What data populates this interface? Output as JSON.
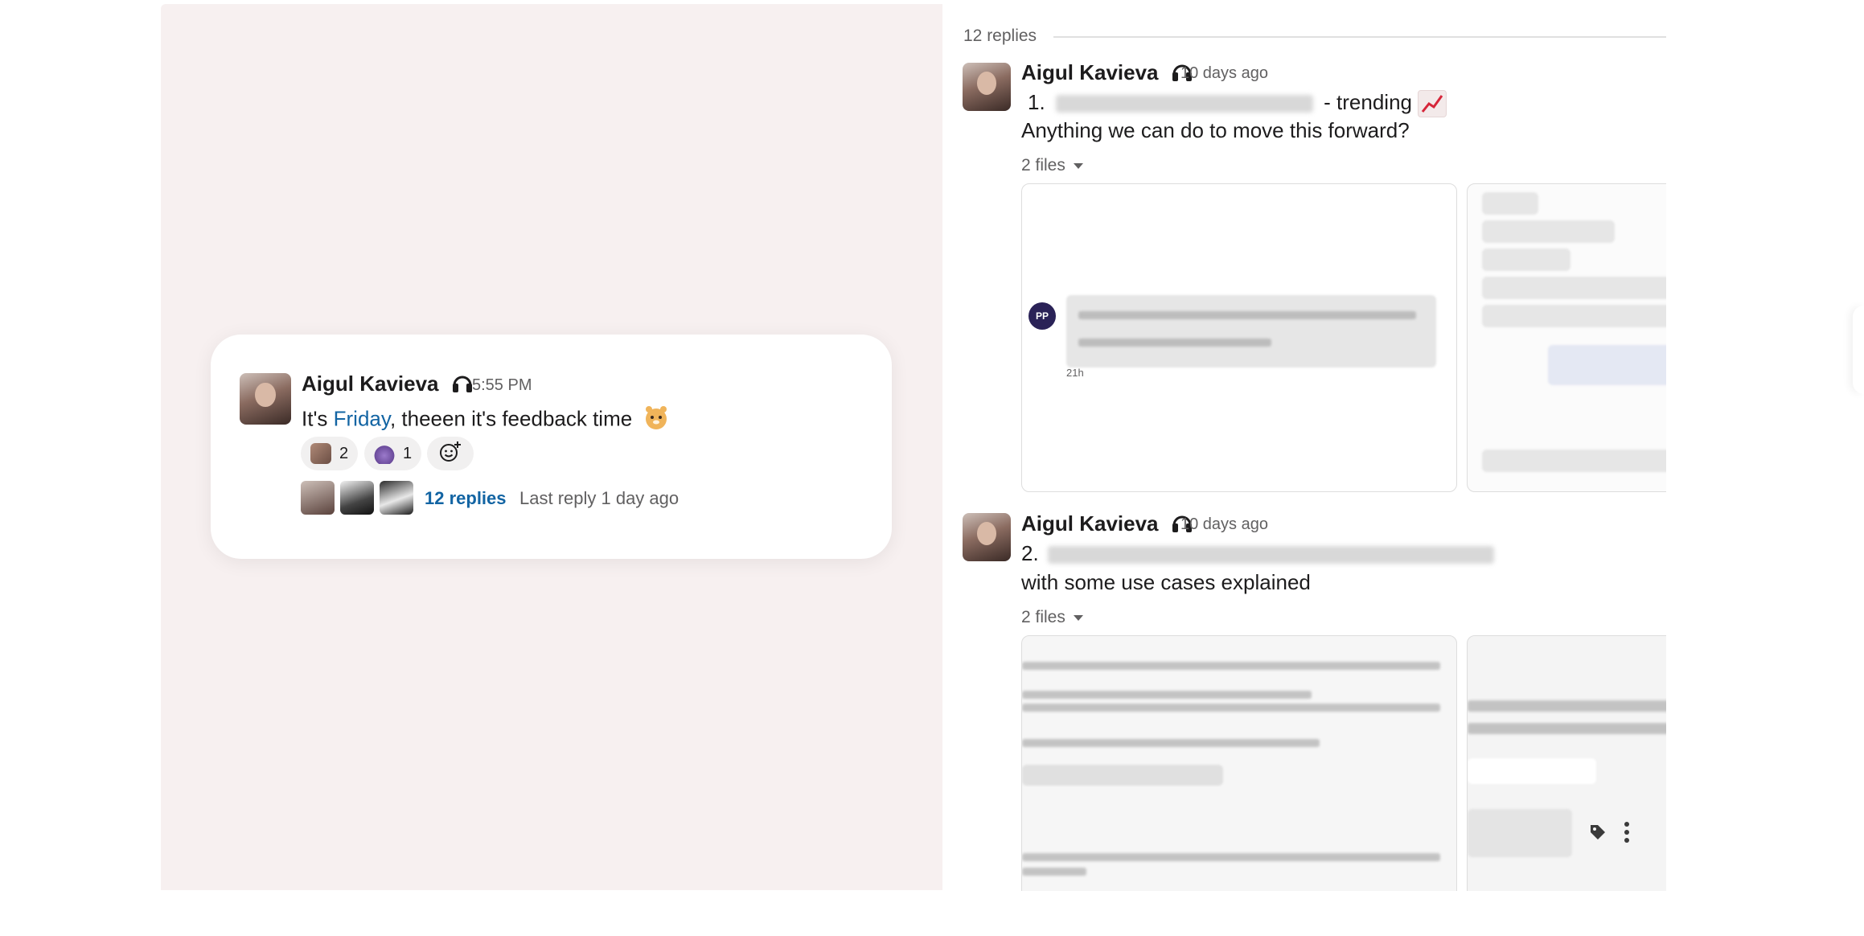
{
  "main_message": {
    "author": "Aigul Kavieva",
    "time": "5:55 PM",
    "text_before": "It's ",
    "text_link": "Friday",
    "text_after": ", theeen it's feedback time",
    "reactions": [
      {
        "emoji": "reaction-emoji-1",
        "count": "2"
      },
      {
        "emoji": "reaction-emoji-2",
        "count": "1"
      }
    ],
    "replies_label": "12 replies",
    "last_reply": "Last reply 1 day ago"
  },
  "thread": {
    "header": "12 replies",
    "messages": [
      {
        "author": "Aigul Kavieva",
        "time": "10 days ago",
        "line1_prefix": "1.",
        "line1_suffix": "- trending",
        "line2": "Anything we can do to move this forward?",
        "files_label": "2 files"
      },
      {
        "author": "Aigul Kavieva",
        "time": "10 days ago",
        "line1_prefix": "2.",
        "line2": "with some use cases explained",
        "files_label": "2 files"
      }
    ],
    "file_preview": {
      "badge": "PP",
      "time": "21h"
    }
  },
  "colors": {
    "link": "#1264a3",
    "panel_bg": "#f7f0f0",
    "badge": "#2a2257"
  }
}
